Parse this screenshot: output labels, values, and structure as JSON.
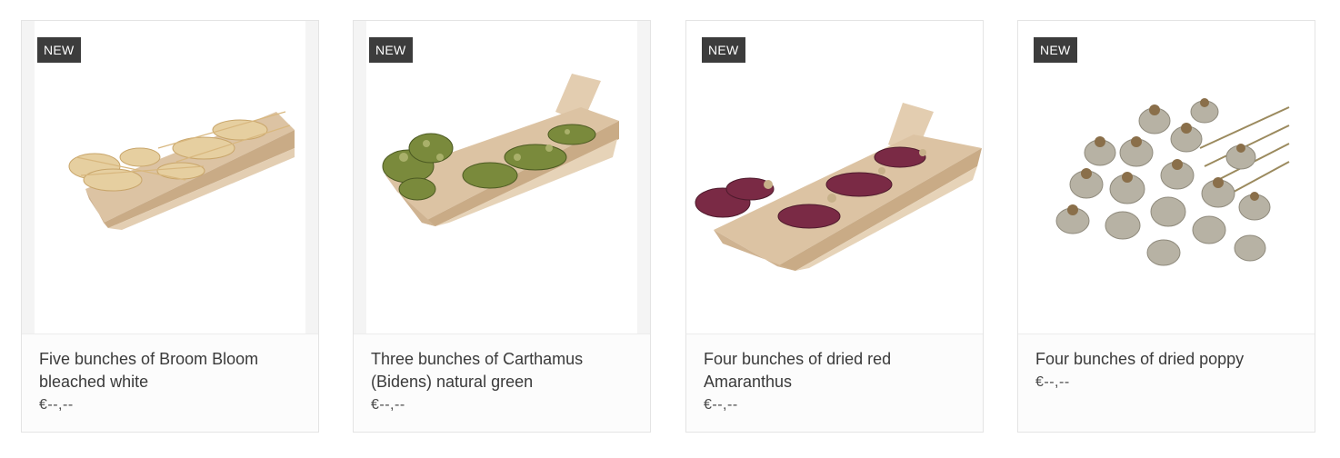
{
  "products": [
    {
      "badge": "NEW",
      "title": "Five bunches of Broom Bloom bleached white",
      "price": "€--,--",
      "image_icon": "broom-bloom-box-image",
      "colors": {
        "flower": "#e6cfa0",
        "flower_dark": "#c8a56a"
      }
    },
    {
      "badge": "NEW",
      "title": "Three bunches of Carthamus (Bidens) natural green",
      "price": "€--,--",
      "image_icon": "carthamus-box-image",
      "colors": {
        "flower": "#7a8a3c",
        "flower_dark": "#4c5a22"
      }
    },
    {
      "badge": "NEW",
      "title": "Four bunches of dried red Amaranthus",
      "price": "€--,--",
      "image_icon": "amaranthus-box-image",
      "colors": {
        "flower": "#7a2a45",
        "flower_dark": "#4e1a2c"
      }
    },
    {
      "badge": "NEW",
      "title": "Four bunches of dried poppy",
      "price": "€--,--",
      "image_icon": "poppy-bunch-image",
      "colors": {
        "flower": "#b7b2a4",
        "flower_dark": "#8a6f4a"
      }
    }
  ],
  "colors": {
    "badge_bg": "#3c3c3c",
    "box": "#dcc3a3",
    "box_inner": "#c9ab86",
    "border": "#e4e4e4"
  }
}
